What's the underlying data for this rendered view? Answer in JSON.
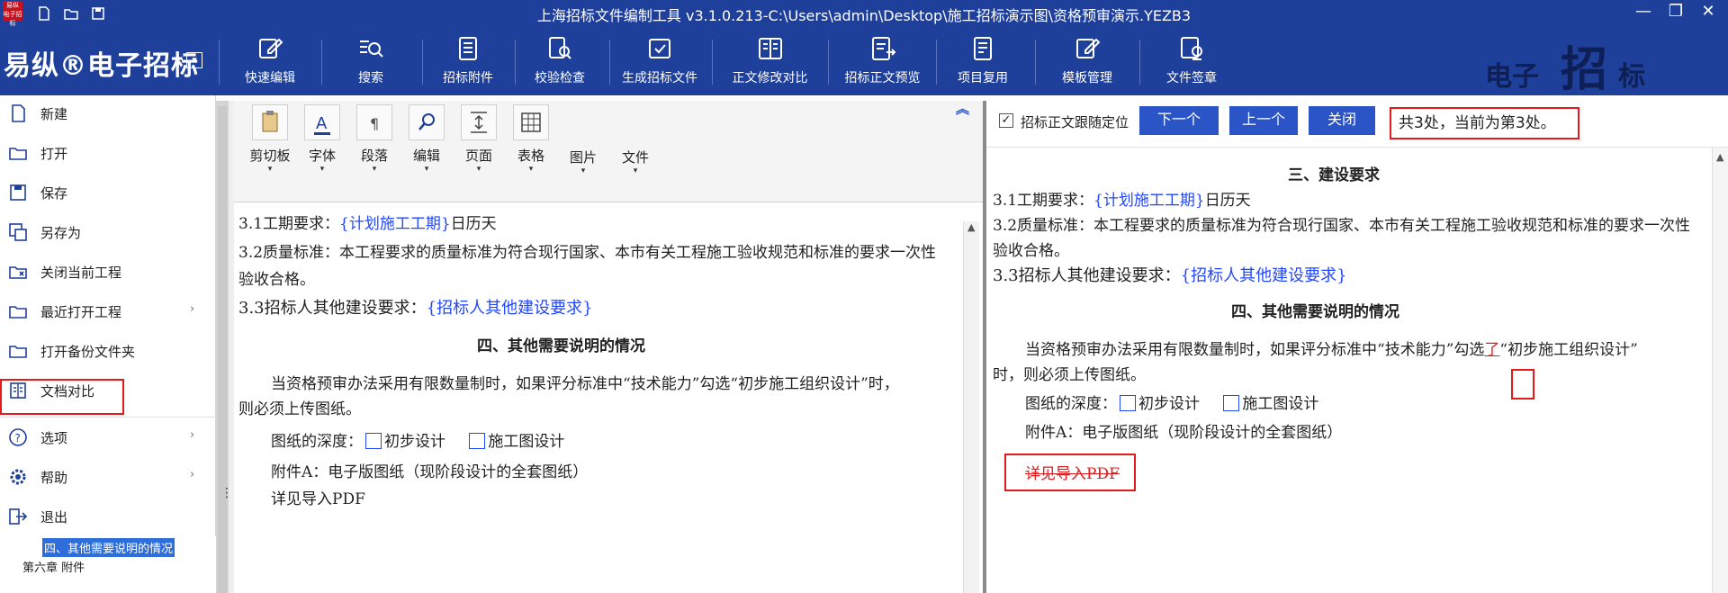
{
  "window": {
    "title": "上海招标文件编制工具 v3.1.0.213-C:\\Users\\admin\\Desktop\\施工招标演示图\\资格预审演示.YEZB3",
    "logo_text": "易纵 电子招标",
    "minimize": "—",
    "restore": "❐",
    "close": "✕"
  },
  "ribbon": {
    "brand": "易纵®电子招标",
    "tools": [
      {
        "label": "快速编辑",
        "icon": "edit-icon"
      },
      {
        "label": "搜索",
        "icon": "search-list-icon"
      },
      {
        "label": "招标附件",
        "icon": "attachment-icon"
      },
      {
        "label": "校验检查",
        "icon": "check-doc-icon"
      },
      {
        "label": "生成招标文件",
        "icon": "generate-icon"
      },
      {
        "label": "正文修改对比",
        "icon": "compare-icon"
      },
      {
        "label": "招标正文预览",
        "icon": "preview-icon"
      },
      {
        "label": "项目复用",
        "icon": "reuse-icon"
      },
      {
        "label": "模板管理",
        "icon": "template-icon"
      },
      {
        "label": "文件签章",
        "icon": "sign-icon"
      }
    ],
    "watermark": {
      "s1": "电子",
      "big": "招",
      "s2": "标"
    }
  },
  "file_menu": {
    "items": [
      {
        "label": "新建",
        "icon": "new-file-icon"
      },
      {
        "label": "打开",
        "icon": "open-folder-icon"
      },
      {
        "label": "保存",
        "icon": "save-icon"
      },
      {
        "label": "另存为",
        "icon": "save-as-icon"
      },
      {
        "label": "关闭当前工程",
        "icon": "close-project-icon"
      },
      {
        "label": "最近打开工程",
        "icon": "recent-folder-icon",
        "submenu": true
      },
      {
        "label": "打开备份文件夹",
        "icon": "backup-folder-icon"
      },
      {
        "label": "文档对比",
        "icon": "doc-compare-icon",
        "highlighted": true
      },
      {
        "label": "选项",
        "icon": "help-circle-icon",
        "submenu": true
      },
      {
        "label": "帮助",
        "icon": "gear-icon",
        "submenu": true
      },
      {
        "label": "退出",
        "icon": "exit-icon"
      }
    ],
    "arrow": "›"
  },
  "tree": {
    "selected": "四、其他需要说明的情况",
    "next": "第六章 附件"
  },
  "editor_ribbon": {
    "groups": [
      {
        "label": "剪切板",
        "icon": "clipboard-icon"
      },
      {
        "label": "字体",
        "icon": "font-icon"
      },
      {
        "label": "段落",
        "icon": "paragraph-icon"
      },
      {
        "label": "编辑",
        "icon": "find-icon"
      },
      {
        "label": "页面",
        "icon": "page-icon"
      },
      {
        "label": "表格",
        "icon": "table-icon"
      },
      {
        "label": "图片",
        "icon": ""
      },
      {
        "label": "文件",
        "icon": ""
      }
    ],
    "dropdown": "▾",
    "collapse": "︽"
  },
  "left_doc": {
    "l1_prefix": "3.1工期要求：",
    "l1_field": "{计划施工工期}",
    "l1_suffix": "日历天",
    "l2": "3.2质量标准：本工程要求的质量标准为符合现行国家、本市有关工程施工验收规范和标准的要求一次性",
    "l3": "验收合格。",
    "l4_prefix": "3.3招标人其他建设要求：",
    "l4_field": "{招标人其他建设要求}",
    "heading": "四、其他需要说明的情况",
    "p1": "当资格预审办法采用有限数量制时，如果评分标准中“技术能力”勾选“初步施工组织设计”时，",
    "p2": "则必须上传图纸。",
    "depth_label": "图纸的深度：",
    "opt1": "初步设计",
    "opt2": "施工图设计",
    "attach": "附件A：电子版图纸（现阶段设计的全套图纸）",
    "import": "详见导入PDF"
  },
  "compare": {
    "follow_label": "招标正文跟随定位",
    "follow_checked": "✓",
    "next_btn": "下一个",
    "prev_btn": "上一个",
    "close_btn": "关闭",
    "status": "共3处，当前为第3处。"
  },
  "right_doc": {
    "heading3": "三、建设要求",
    "l1_prefix": "3.1工期要求：",
    "l1_field": "{计划施工工期}",
    "l1_suffix": "日历天",
    "l2": "3.2质量标准：本工程要求的质量标准为符合现行国家、本市有关工程施工验收规范和标准的要求一次性",
    "l3": "验收合格。",
    "l4_prefix": "3.3招标人其他建设要求：",
    "l4_field": "{招标人其他建设要求}",
    "heading4": "四、其他需要说明的情况",
    "p1_a": "当资格预审办法采用有限数量制时，如果评分标准中“技术能力”勾选",
    "p1_mark": "了",
    "p1_b": "“初步施工组织设计”",
    "p2": "时，则必须上传图纸。",
    "depth_label": "图纸的深度：",
    "opt1": "初步设计",
    "opt2": "施工图设计",
    "attach": "附件A：电子版图纸（现阶段设计的全套图纸）",
    "import_deleted": "详见导入PDF"
  }
}
